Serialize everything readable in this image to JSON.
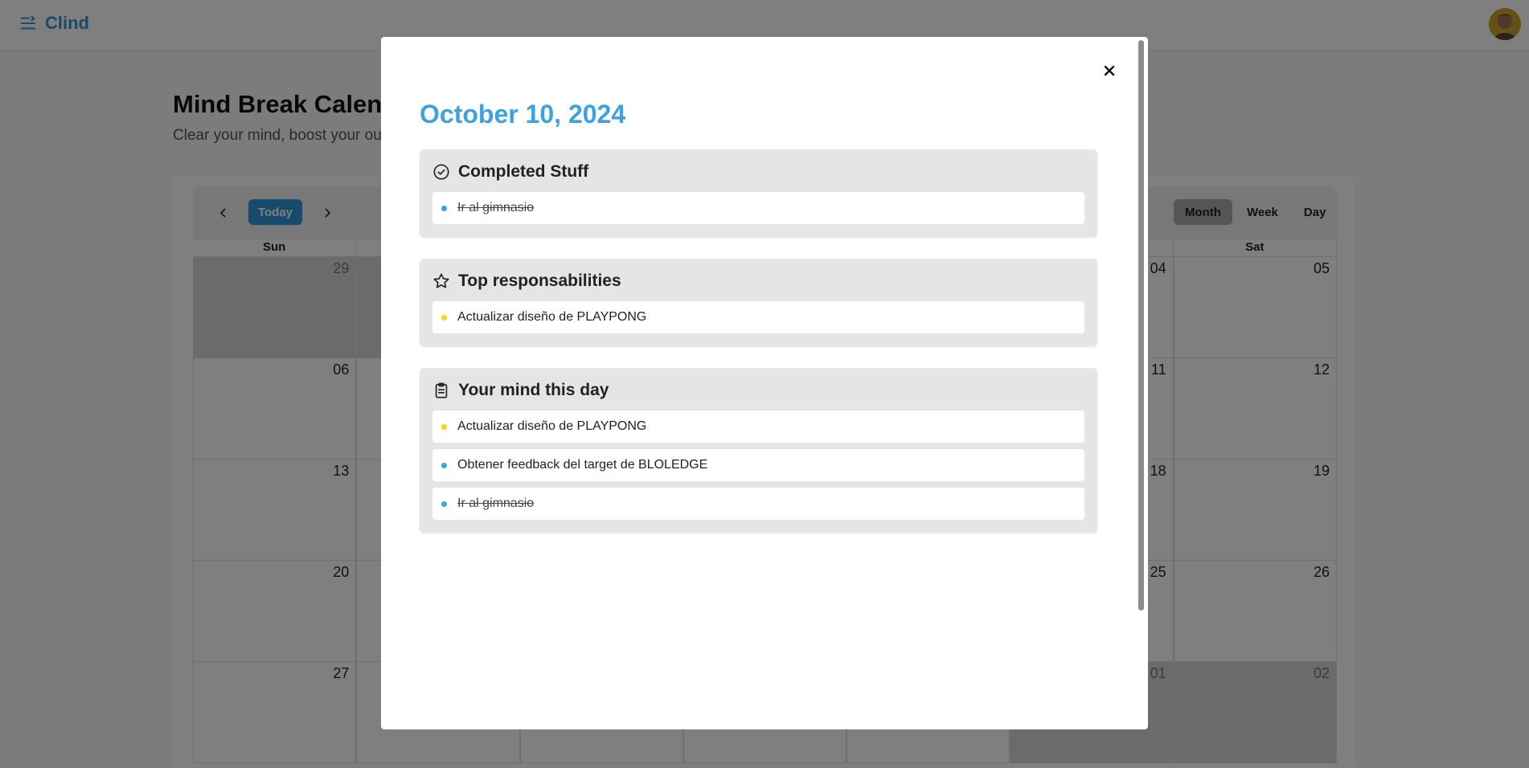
{
  "app": {
    "name": "Clind"
  },
  "page": {
    "title": "Mind Break Calend",
    "subtitle": "Clear your mind, boost your outp"
  },
  "calendar": {
    "today_label": "Today",
    "views": [
      {
        "label": "Month",
        "active": true
      },
      {
        "label": "Week",
        "active": false
      },
      {
        "label": "Day",
        "active": false
      }
    ],
    "weekdays": [
      "Sun",
      "",
      "",
      "",
      "",
      "",
      "Sat"
    ],
    "weeks": [
      [
        {
          "d": "29",
          "out": true
        },
        {
          "d": "",
          "out": true
        },
        {
          "d": "",
          "out": false
        },
        {
          "d": "",
          "out": false
        },
        {
          "d": "",
          "out": false
        },
        {
          "d": "04",
          "out": false
        },
        {
          "d": "05",
          "out": false
        }
      ],
      [
        {
          "d": "06",
          "out": false
        },
        {
          "d": "",
          "out": false
        },
        {
          "d": "",
          "out": false
        },
        {
          "d": "",
          "out": false
        },
        {
          "d": "",
          "out": false
        },
        {
          "d": "11",
          "out": false
        },
        {
          "d": "12",
          "out": false
        }
      ],
      [
        {
          "d": "13",
          "out": false
        },
        {
          "d": "",
          "out": false
        },
        {
          "d": "",
          "out": false
        },
        {
          "d": "",
          "out": false
        },
        {
          "d": "",
          "out": false
        },
        {
          "d": "18",
          "out": false
        },
        {
          "d": "19",
          "out": false
        }
      ],
      [
        {
          "d": "20",
          "out": false
        },
        {
          "d": "",
          "out": false
        },
        {
          "d": "",
          "out": false
        },
        {
          "d": "",
          "out": false
        },
        {
          "d": "",
          "out": false
        },
        {
          "d": "25",
          "out": false
        },
        {
          "d": "26",
          "out": false
        }
      ],
      [
        {
          "d": "27",
          "out": false
        },
        {
          "d": "",
          "out": false
        },
        {
          "d": "",
          "out": false
        },
        {
          "d": "",
          "out": false
        },
        {
          "d": "",
          "out": false
        },
        {
          "d": "01",
          "out": true
        },
        {
          "d": "02",
          "out": true
        }
      ]
    ]
  },
  "modal": {
    "date": "October 10, 2024",
    "colors": {
      "accent": "#3ba3e0",
      "dot_blue": "#3ba3e0",
      "dot_yellow": "#f5d90a"
    },
    "sections": [
      {
        "title": "Completed Stuff",
        "icon": "check-circle-icon",
        "items": [
          {
            "text": "Ir al gimnasio",
            "color": "#3ba3e0",
            "done": true
          }
        ]
      },
      {
        "title": "Top responsabilities",
        "icon": "star-icon",
        "items": [
          {
            "text": "Actualizar diseño de PLAYPONG",
            "color": "#f5d90a",
            "done": false
          }
        ]
      },
      {
        "title": "Your mind this day",
        "icon": "clipboard-icon",
        "items": [
          {
            "text": "Actualizar diseño de PLAYPONG",
            "color": "#f5d90a",
            "done": false
          },
          {
            "text": "Obtener feedback del target de BLOLEDGE",
            "color": "#3ba3e0",
            "done": false
          },
          {
            "text": "Ir al gimnasio",
            "color": "#3ba3e0",
            "done": true
          }
        ]
      }
    ]
  }
}
